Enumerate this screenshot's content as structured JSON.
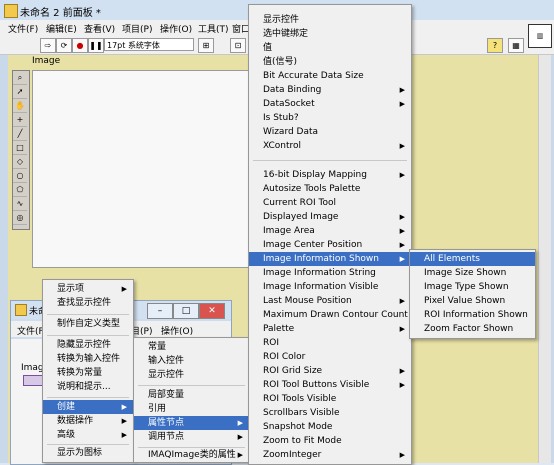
{
  "main_window": {
    "title": "未命名 2 前面板 *",
    "menu": [
      "文件(F)",
      "编辑(E)",
      "查看(V)",
      "项目(P)",
      "操作(O)",
      "工具(T)",
      "窗口"
    ],
    "font_select": "17pt 系统字体",
    "image_label": "Image",
    "palette_icons": [
      "magnifier-icon",
      "arrow-icon",
      "hand-icon",
      "point-icon",
      "line-icon",
      "rectangle-icon",
      "rotated-rect-icon",
      "oval-icon",
      "polygon-icon",
      "freehand-icon",
      "annulus-icon",
      "broken-line-icon",
      "free-line-icon"
    ]
  },
  "second_window": {
    "title": "未命",
    "menu": [
      "文件(F)",
      "目(P)",
      "操作(O)"
    ],
    "control_label": "Imag"
  },
  "context_menu": {
    "items": [
      {
        "label": "显示项",
        "arrow": true
      },
      {
        "label": "查找显示控件",
        "arrow": false
      },
      {
        "label": "制作自定义类型",
        "arrow": false
      },
      {
        "label": "隐藏显示控件",
        "arrow": false
      },
      {
        "label": "转换为输入控件",
        "arrow": false
      },
      {
        "label": "转换为常量",
        "arrow": false
      },
      {
        "label": "说明和提示...",
        "arrow": false
      },
      {
        "label": "创建",
        "arrow": true,
        "selected": true
      },
      {
        "label": "数据操作",
        "arrow": true
      },
      {
        "label": "高级",
        "arrow": true
      },
      {
        "label": "显示为图标",
        "arrow": false
      }
    ]
  },
  "create_submenu": {
    "items": [
      {
        "label": "常量"
      },
      {
        "label": "输入控件"
      },
      {
        "label": "显示控件"
      },
      {
        "label": "局部变量"
      },
      {
        "label": "引用"
      },
      {
        "label": "属性节点",
        "arrow": true,
        "selected": true
      },
      {
        "label": "调用节点",
        "arrow": true
      },
      {
        "label": "IMAQImage类的属性",
        "arrow": true
      }
    ]
  },
  "property_menu": {
    "items": [
      {
        "label": "显示控件"
      },
      {
        "label": "选中键绑定"
      },
      {
        "label": "值"
      },
      {
        "label": "值(信号)"
      },
      {
        "label": "Bit Accurate Data Size"
      },
      {
        "label": "Data Binding",
        "arrow": true
      },
      {
        "label": "DataSocket",
        "arrow": true
      },
      {
        "label": "Is Stub?"
      },
      {
        "label": "Wizard Data"
      },
      {
        "label": "XControl",
        "arrow": true
      },
      {
        "label": "16-bit Display Mapping",
        "arrow": true
      },
      {
        "label": "Autosize Tools Palette"
      },
      {
        "label": "Current ROI Tool"
      },
      {
        "label": "Displayed Image",
        "arrow": true
      },
      {
        "label": "Image Area",
        "arrow": true
      },
      {
        "label": "Image Center Position",
        "arrow": true
      },
      {
        "label": "Image Information Shown",
        "arrow": true,
        "selected": true
      },
      {
        "label": "Image Information String"
      },
      {
        "label": "Image Information Visible"
      },
      {
        "label": "Last Mouse Position",
        "arrow": true
      },
      {
        "label": "Maximum Drawn Contour Count"
      },
      {
        "label": "Palette",
        "arrow": true
      },
      {
        "label": "ROI"
      },
      {
        "label": "ROI Color"
      },
      {
        "label": "ROI Grid Size",
        "arrow": true
      },
      {
        "label": "ROI Tool Buttons Visible",
        "arrow": true
      },
      {
        "label": "ROI Tools Visible"
      },
      {
        "label": "Scrollbars Visible"
      },
      {
        "label": "Snapshot Mode"
      },
      {
        "label": "Zoom to Fit Mode"
      },
      {
        "label": "ZoomInteger",
        "arrow": true
      }
    ]
  },
  "info_submenu": {
    "items": [
      {
        "label": "All Elements",
        "selected": true
      },
      {
        "label": "Image Size Shown"
      },
      {
        "label": "Image Type Shown"
      },
      {
        "label": "Pixel Value Shown"
      },
      {
        "label": "ROI Information Shown"
      },
      {
        "label": "Zoom Factor Shown"
      }
    ]
  },
  "colors": {
    "highlight": "#3a6fc4",
    "panel": "#e8e1a5"
  }
}
